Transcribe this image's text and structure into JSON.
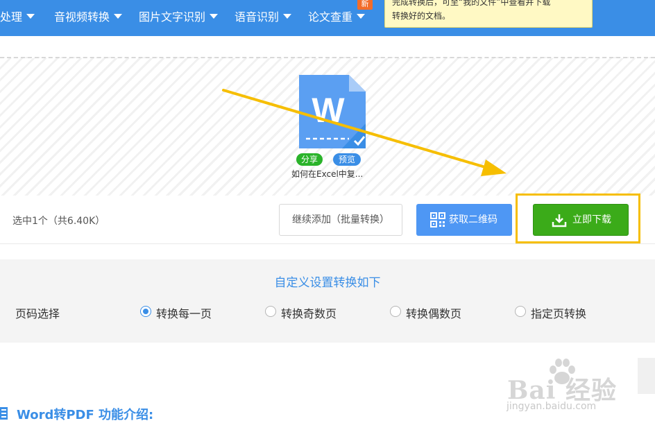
{
  "nav": {
    "items": [
      {
        "label": "处理"
      },
      {
        "label": "音视频转换"
      },
      {
        "label": "图片文字识别"
      },
      {
        "label": "语音识别"
      },
      {
        "label": "论文查重"
      }
    ],
    "new_badge": "新",
    "tooltip_lines": [
      "完成转换后，可至“我的文件”中查看并下载",
      "转换好的文档。"
    ]
  },
  "file": {
    "icon": "word-document-icon",
    "icon_letter": "W",
    "share_label": "分享",
    "preview_label": "预览",
    "name": "如何在Excel中复..."
  },
  "action_bar": {
    "selected_info": "选中1个（共6.40K）",
    "add_more_label": "继续添加（批量转换）",
    "qr_label": "获取二维码",
    "download_label": "立即下载"
  },
  "settings": {
    "title": "自定义设置转换如下",
    "page_label": "页码选择",
    "options": [
      {
        "label": "转换每一页",
        "checked": true
      },
      {
        "label": "转换奇数页",
        "checked": false
      },
      {
        "label": "转换偶数页",
        "checked": false
      },
      {
        "label": "指定页转换",
        "checked": false
      }
    ]
  },
  "intro": {
    "title": "Word转PDF 功能介绍:"
  },
  "watermark": {
    "text": "Bai 经验",
    "sub": "jingyan.baidu.com"
  },
  "colors": {
    "brand_blue": "#3a8ee6",
    "download_green": "#3bab19",
    "highlight_yellow": "#f6be00"
  }
}
